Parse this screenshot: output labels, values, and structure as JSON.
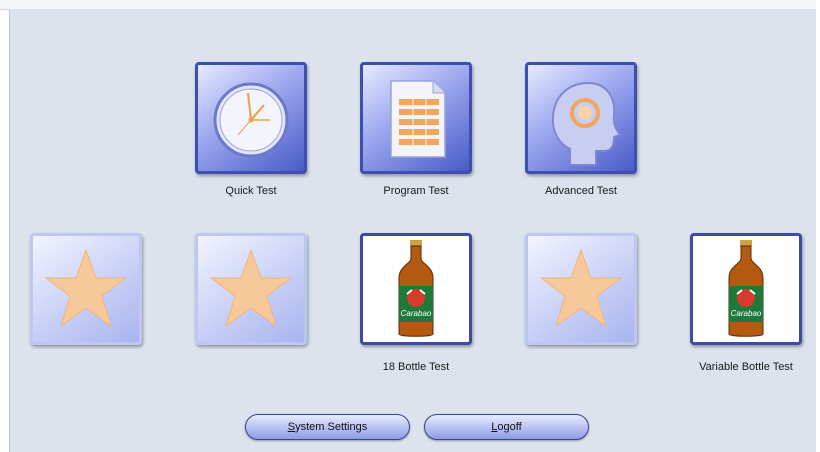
{
  "tiles": {
    "quick_test": {
      "label": "Quick Test",
      "icon": "clock-icon"
    },
    "program_test": {
      "label": "Program Test",
      "icon": "document-icon"
    },
    "advanced_test": {
      "label": "Advanced Test",
      "icon": "head-profile-icon"
    },
    "slot1": {
      "icon": "star-icon"
    },
    "slot2": {
      "icon": "star-icon"
    },
    "bottle18": {
      "label": "18 Bottle Test",
      "icon": "bottle-icon"
    },
    "slot4": {
      "icon": "star-icon"
    },
    "variable_bottle": {
      "label": "Variable Bottle Test",
      "icon": "bottle-icon"
    }
  },
  "buttons": {
    "system_settings": {
      "mnemonic": "S",
      "rest": "ystem Settings"
    },
    "logoff": {
      "mnemonic": "L",
      "rest": "ogoff"
    }
  },
  "bottle": {
    "brand": "Carabao"
  },
  "colors": {
    "panel": "#dce3ec",
    "tile_border": "#3c4fb3",
    "star": "#f7c89a"
  }
}
